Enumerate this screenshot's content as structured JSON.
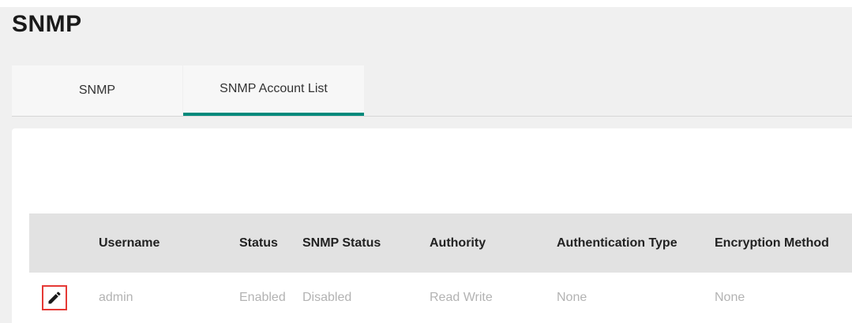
{
  "page": {
    "title": "SNMP"
  },
  "tabs": [
    {
      "label": "SNMP",
      "active": false
    },
    {
      "label": "SNMP Account List",
      "active": true
    }
  ],
  "colors": {
    "accent": "#00897b",
    "highlight_border": "#e53935"
  },
  "table": {
    "columns": [
      "Username",
      "Status",
      "SNMP Status",
      "Authority",
      "Authentication Type",
      "Encryption Method"
    ],
    "rows": [
      {
        "edit_icon": "pencil-icon",
        "cells": [
          "admin",
          "Enabled",
          "Disabled",
          "Read Write",
          "None",
          "None"
        ]
      }
    ]
  }
}
